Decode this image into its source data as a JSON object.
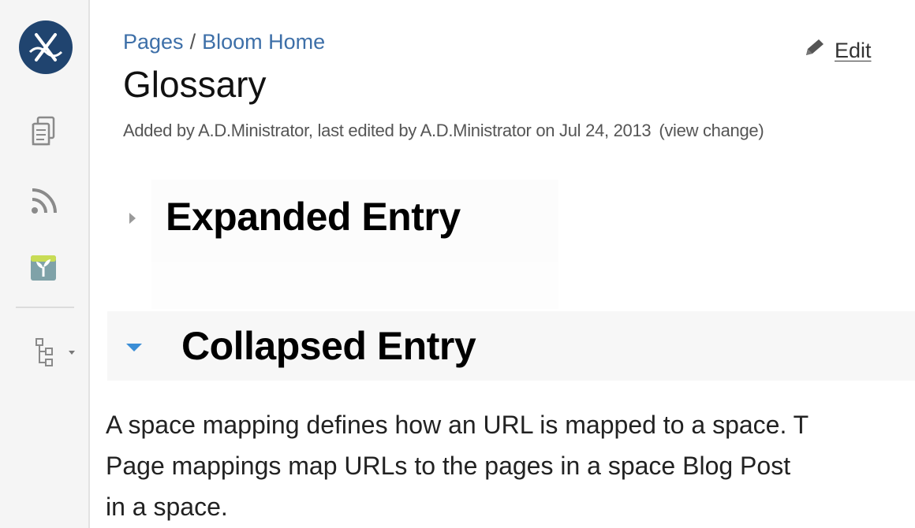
{
  "sidebar": {
    "logo_icon": "space-logo-icon",
    "items": [
      {
        "icon": "pages-icon"
      },
      {
        "icon": "rss-feed-icon"
      },
      {
        "icon": "blog-sprout-icon"
      },
      {
        "icon": "page-tree-icon"
      }
    ],
    "colors": {
      "logo_bg": "#20446f",
      "icon": "#8a8a8a"
    }
  },
  "breadcrumb": {
    "items": [
      "Pages",
      "Bloom Home"
    ],
    "separator": "/"
  },
  "page": {
    "title": "Glossary",
    "edit_label": "Edit",
    "meta": "Added by A.D.Ministrator, last edited by A.D.Ministrator on Jul 24, 2013",
    "view_change": "(view change)"
  },
  "entries": [
    {
      "title": "Expanded Entry",
      "state_icon": "chevron-right-icon"
    },
    {
      "title": "Collapsed Entry",
      "state_icon": "chevron-down-icon"
    }
  ],
  "body": {
    "lines": [
      "A space mapping defines how an URL is mapped to a space. T",
      "Page mappings map URLs to the pages in a space Blog Post",
      "in a space."
    ]
  },
  "colors": {
    "link": "#3d6fa8",
    "accent_arrow": "#3b8ed6"
  }
}
